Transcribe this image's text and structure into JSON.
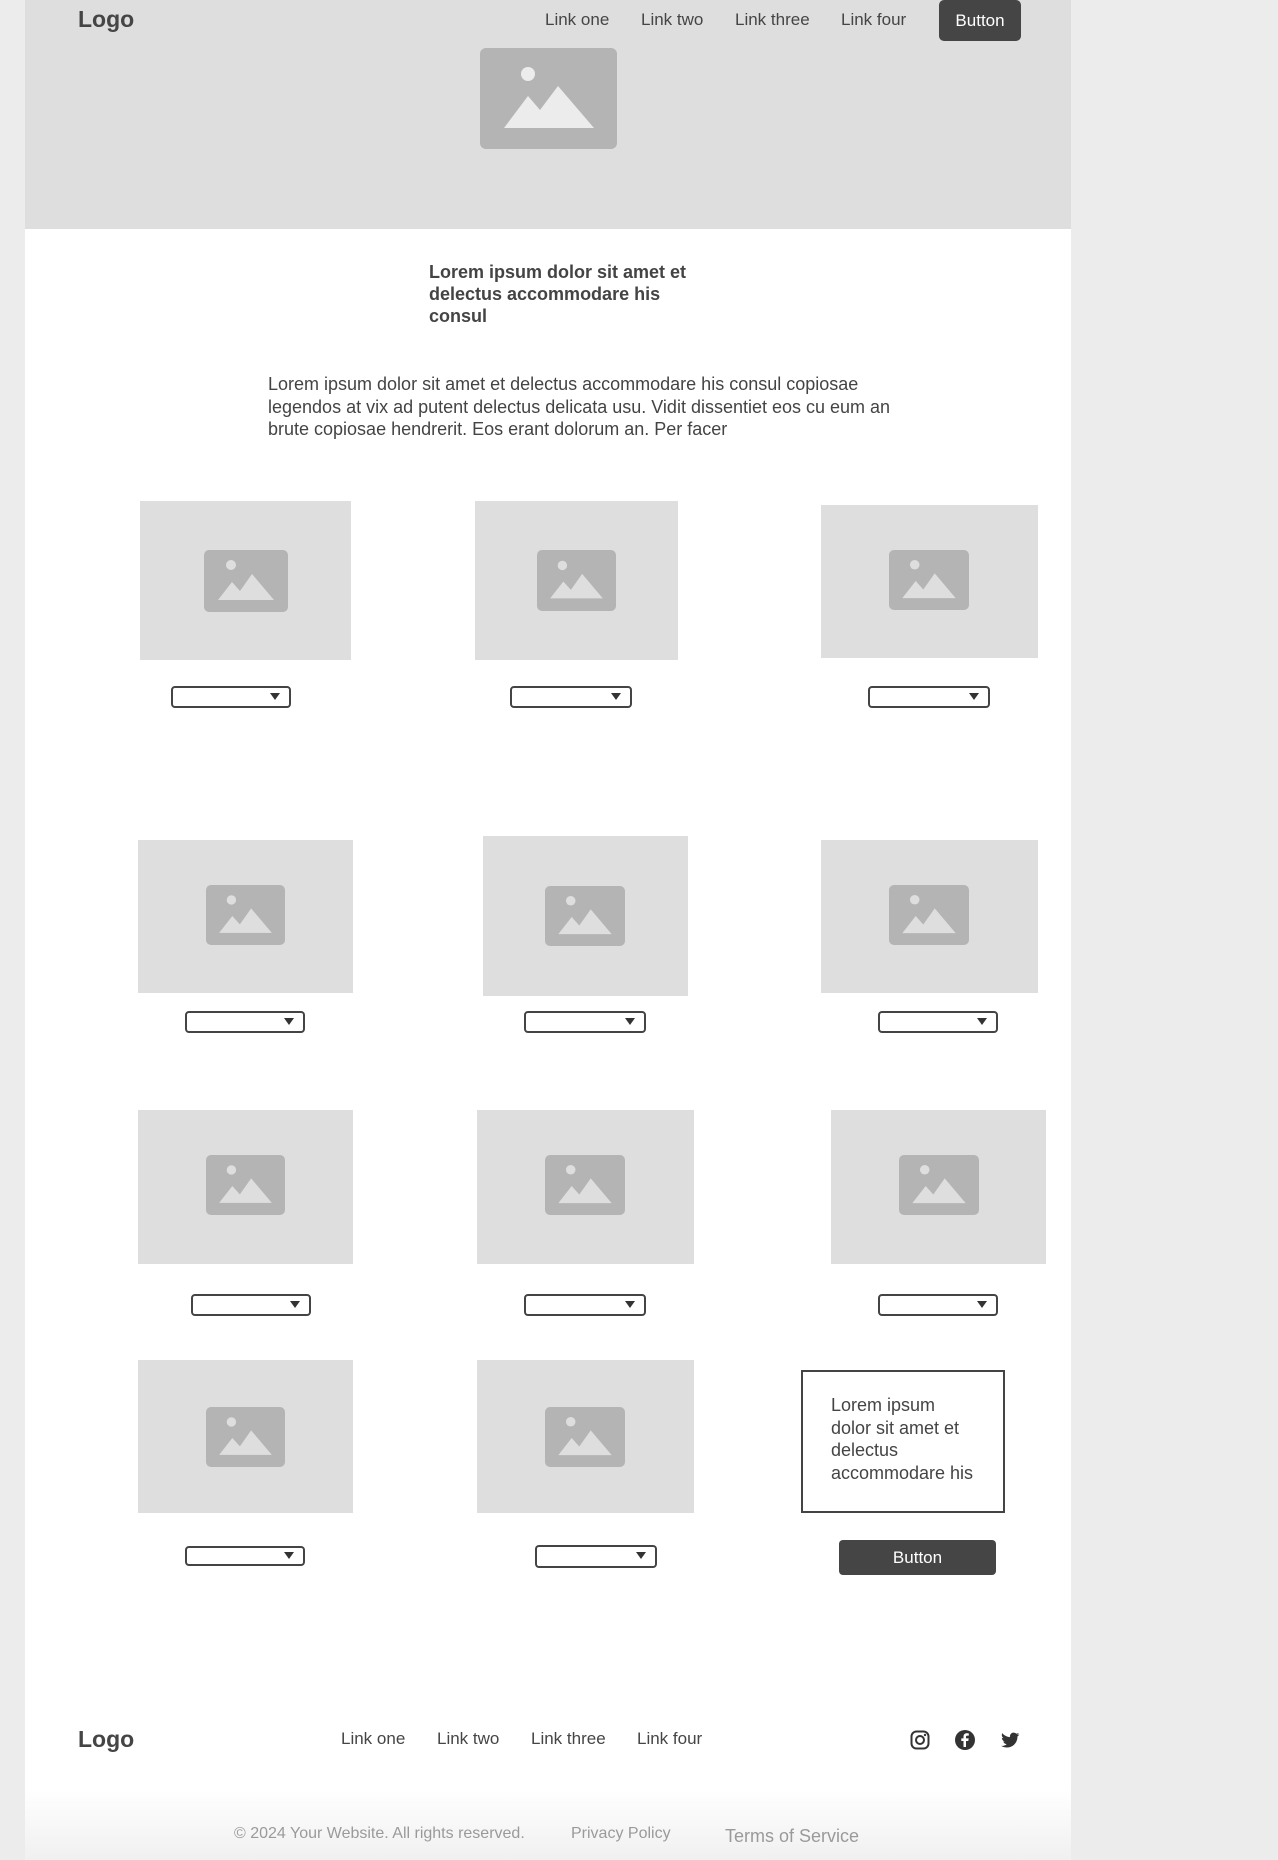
{
  "nav": {
    "logo": "Logo",
    "links": [
      "Link one",
      "Link two",
      "Link three",
      "Link four"
    ],
    "button": "Button"
  },
  "intro": {
    "heading": "Lorem ipsum dolor sit amet et delectus accommodare his consul",
    "paragraph": "Lorem ipsum dolor sit amet et delectus accommodare his consul copiosae legendos at vix ad putent delectus delicata usu. Vidit dissentiet eos cu eum an brute copiosae hendrerit. Eos erant dolorum an. Per facer"
  },
  "text_card": {
    "text": "Lorem ipsum dolor sit amet et delectus accommodare his",
    "button": "Button"
  },
  "footer": {
    "logo": "Logo",
    "links": [
      "Link one",
      "Link two",
      "Link three",
      "Link four"
    ],
    "social_icons": [
      "instagram-icon",
      "facebook-icon",
      "twitter-icon"
    ],
    "copyright": "© 2024 Your Website. All rights reserved.",
    "privacy": "Privacy Policy",
    "terms": "Terms of Service"
  },
  "icons": {
    "image_placeholder": "image-placeholder-icon",
    "dropdown_caret": "chevron-down-icon"
  },
  "colors": {
    "dark": "#454545",
    "placeholder_bg": "#dedede",
    "placeholder_icon": "#b4b4b4",
    "page_bg": "#ececec"
  }
}
